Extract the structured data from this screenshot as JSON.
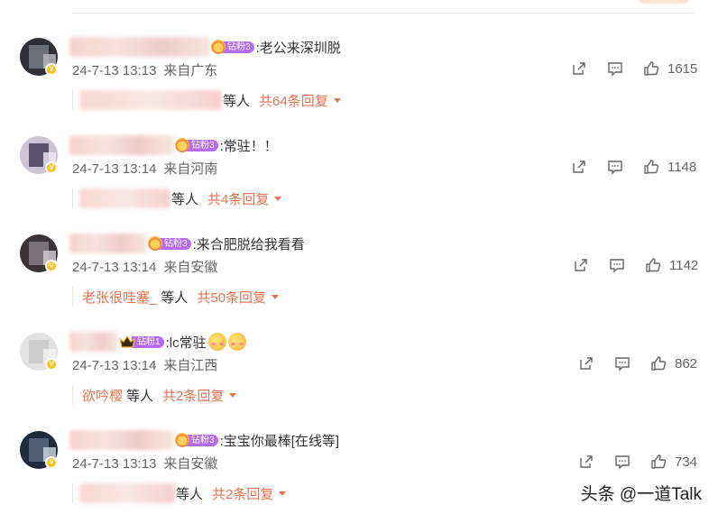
{
  "comments": [
    {
      "username": "分秒订秒错过北京小满",
      "fan_label": "钻粉3",
      "badge_type": "flower",
      "text": ":老公来深圳脱",
      "time": "24-7-13 13:13",
      "location": "来自广东",
      "likes": "1615",
      "reply_name": "小鱼滚滚糖糖酒碗满",
      "reply_deng": "等人",
      "reply_count": "共64条回复",
      "has_emoji": false
    },
    {
      "username": "小猫猫的星星",
      "fan_label": "钻粉3",
      "badge_type": "flower",
      "text": ":常驻！！",
      "time": "24-7-13 13:14",
      "location": "来自河南",
      "likes": "1148",
      "reply_name": "我是你的星",
      "reply_deng": "等人",
      "reply_count": "共4条回复",
      "has_emoji": false
    },
    {
      "username": "老张很哇塞_",
      "fan_label": "钻粉3",
      "badge_type": "flower",
      "text": ":来合肥脱给我看看",
      "time": "24-7-13 13:14",
      "location": "来自安徽",
      "likes": "1142",
      "reply_name": "老张很哇塞_",
      "reply_deng": "等人",
      "reply_count": "共50条回复",
      "has_emoji": false
    },
    {
      "username": "欲吟樱",
      "fan_label": "钻粉1",
      "badge_type": "crown",
      "text": ":lc常驻",
      "time": "24-7-13 13:14",
      "location": "来自江西",
      "likes": "862",
      "reply_name": "欲吟樱",
      "reply_deng": "等人",
      "reply_count": "共2条回复",
      "has_emoji": true
    },
    {
      "username": "甜甜我就是你的",
      "fan_label": "钻粉3",
      "badge_type": "flower",
      "text": ":宝宝你最棒[在线等]",
      "time": "24-7-13 13:13",
      "location": "来自安徽",
      "likes": "734",
      "reply_name": "小可爱你",
      "reply_deng": "等人",
      "reply_count": "共2条回复",
      "has_emoji": false
    }
  ],
  "watermark": "头条 @一道Talk",
  "colors": {
    "accent": "#eb7350",
    "fan_badge": "#b56cf3",
    "meta": "#666666"
  },
  "icons": [
    "share-icon",
    "comment-icon",
    "like-icon",
    "caret-down-icon",
    "verified-badge-icon",
    "fan-badge-icon",
    "emoji-icon"
  ]
}
